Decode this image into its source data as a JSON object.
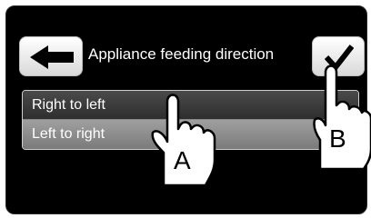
{
  "header": {
    "title": "Appliance feeding direction",
    "back_icon": "arrow-left-icon",
    "confirm_icon": "checkmark-icon"
  },
  "options": [
    {
      "label": "Right to left",
      "selected": true
    },
    {
      "label": "Left to right",
      "selected": false
    }
  ],
  "callouts": {
    "a": "A",
    "b": "B"
  }
}
